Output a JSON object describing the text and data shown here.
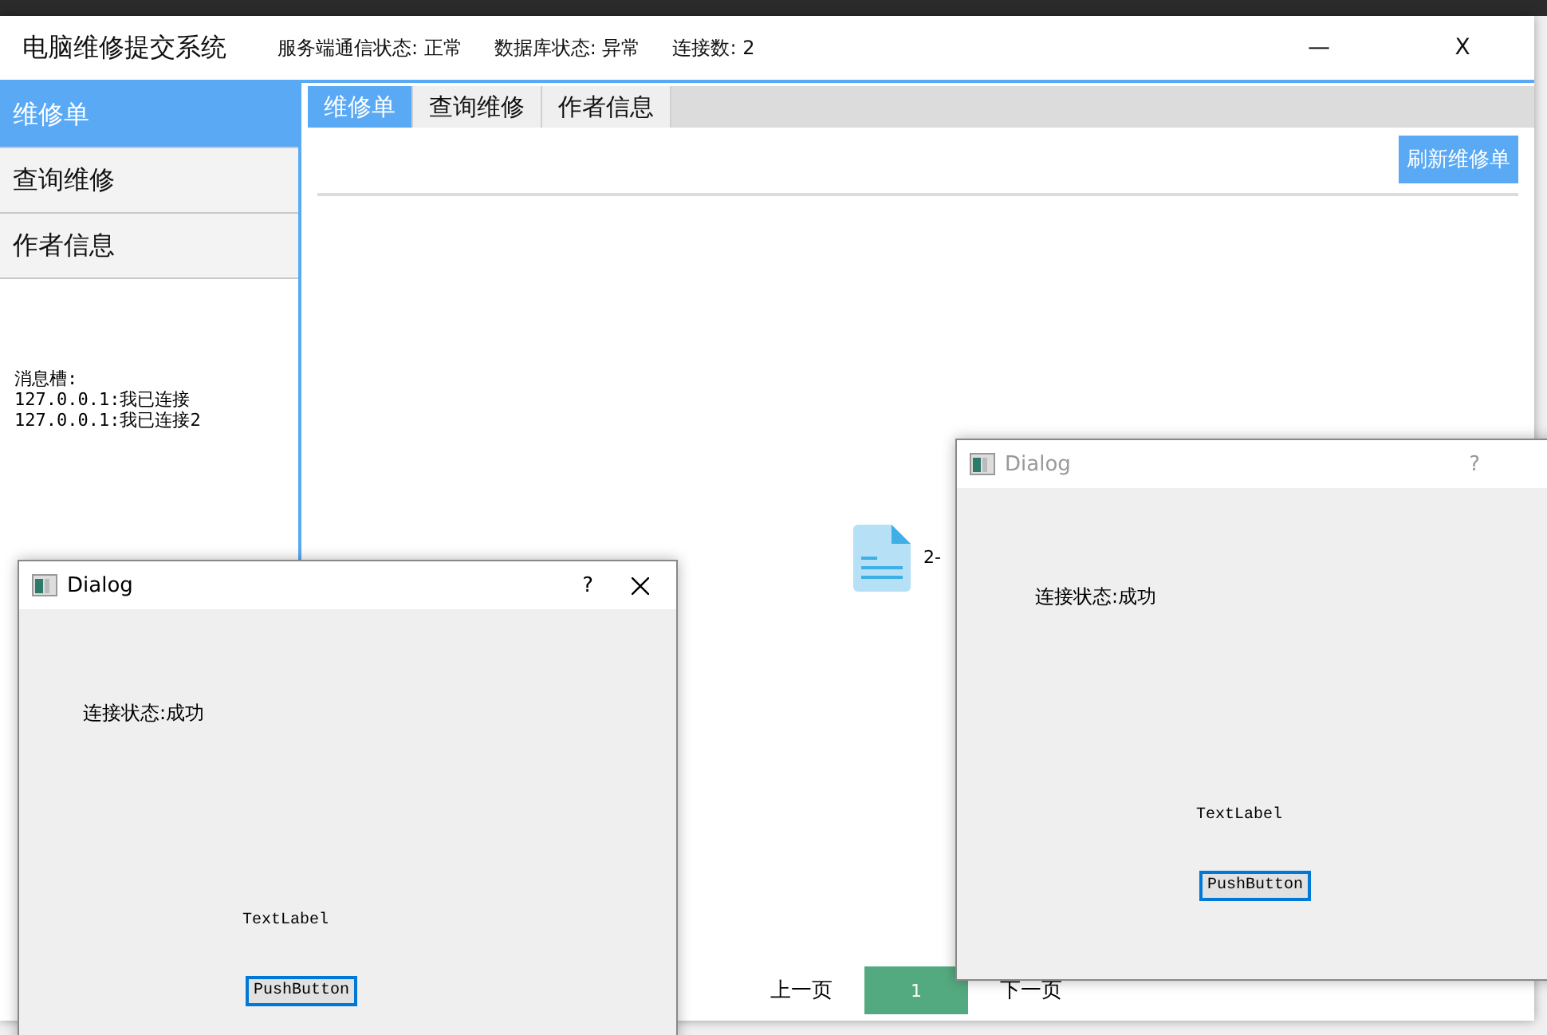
{
  "main_window": {
    "title": "电脑维修提交系统",
    "status": [
      "服务端通信状态: 正常",
      "数据库状态: 异常",
      "连接数: 2"
    ],
    "minimize": "—",
    "close": "X"
  },
  "sidebar": {
    "items": [
      {
        "label": "维修单",
        "selected": true
      },
      {
        "label": "查询维修",
        "selected": false
      },
      {
        "label": "作者信息",
        "selected": false
      }
    ]
  },
  "messages": {
    "title": "消息槽:",
    "lines": [
      "127.0.0.1:我已连接",
      "127.0.0.1:我已连接2"
    ]
  },
  "tabs": [
    {
      "label": "维修单",
      "selected": true
    },
    {
      "label": "查询维修",
      "selected": false
    },
    {
      "label": "作者信息",
      "selected": false
    }
  ],
  "refresh_button": "刷新维修单",
  "file_item": {
    "label": "2-"
  },
  "pagination": {
    "prev": "上一页",
    "pages": [
      {
        "label": "1",
        "selected": true
      }
    ],
    "next": "下一页"
  },
  "dialogs": [
    {
      "title": "Dialog",
      "active": true,
      "help": "?",
      "status": "连接状态:成功",
      "text_label": "TextLabel",
      "button": "PushButton"
    },
    {
      "title": "Dialog",
      "active": false,
      "help": "?",
      "status": "连接状态:成功",
      "text_label": "TextLabel",
      "button": "PushButton"
    }
  ]
}
